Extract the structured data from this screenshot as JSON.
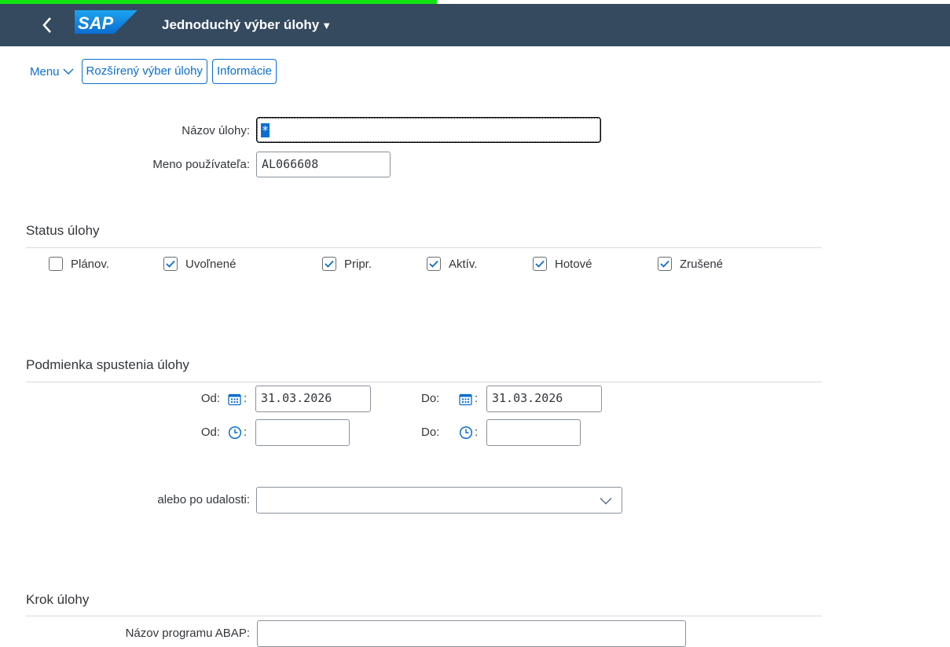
{
  "shell": {
    "back_label": "<",
    "logo_text": "SAP",
    "title": "Jednoduchý výber úlohy",
    "title_caret": "▼"
  },
  "toolbar": {
    "menu_label": "Menu",
    "extended_label": "Rozšírený výber úlohy",
    "info_label": "Informácie"
  },
  "form": {
    "job_name_label": "Názov úlohy:",
    "job_name_value": "*",
    "user_label": "Meno používateľa:",
    "user_value": "AL066608"
  },
  "status": {
    "title": "Status úlohy",
    "items": [
      {
        "label": "Plánov.",
        "checked": false
      },
      {
        "label": "Uvoľnené",
        "checked": true
      },
      {
        "label": "Pripr.",
        "checked": true
      },
      {
        "label": "Aktív.",
        "checked": true
      },
      {
        "label": "Hotové",
        "checked": true
      },
      {
        "label": "Zrušené",
        "checked": true
      }
    ]
  },
  "start": {
    "title": "Podmienka spustenia úlohy",
    "from_label": "Od:",
    "to_label": "Do:",
    "colon": ":",
    "from_date": "31.03.2026",
    "to_date": "31.03.2026",
    "from_time": "",
    "to_time": "",
    "event_label": "alebo po udalosti:",
    "event_value": ""
  },
  "step": {
    "title": "Krok úlohy",
    "program_label": "Názov programu ABAP:",
    "program_value": ""
  },
  "icons": {
    "calendar": "calendar-icon",
    "clock": "clock-icon",
    "check": "check-icon",
    "dropdown": "chevron-down-icon"
  },
  "colors": {
    "shell": "#354a5f",
    "accent": "#0a6ed1",
    "strip": "#11e611"
  }
}
